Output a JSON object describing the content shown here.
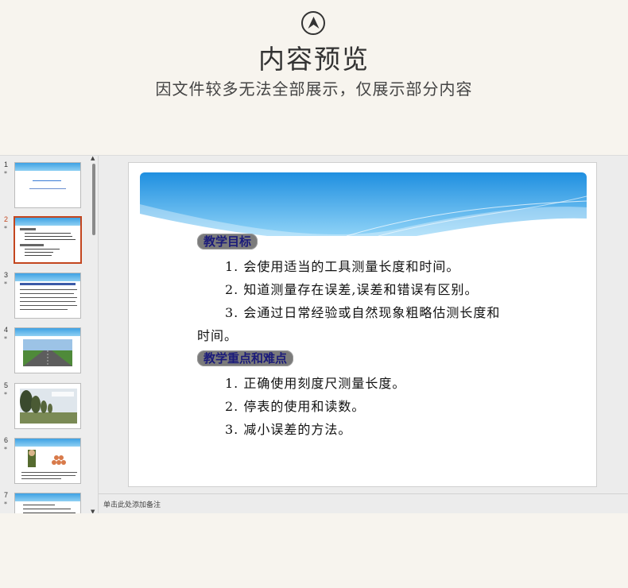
{
  "header": {
    "title": "内容预览",
    "subtitle": "因文件较多无法全部展示，仅展示部分内容",
    "icon": "upload-arrow-icon"
  },
  "thumbnails": [
    {
      "num": "1",
      "star": "*",
      "kind": "title"
    },
    {
      "num": "2",
      "star": "*",
      "kind": "text",
      "active": true
    },
    {
      "num": "3",
      "star": "*",
      "kind": "text"
    },
    {
      "num": "4",
      "star": "*",
      "kind": "road-photo"
    },
    {
      "num": "5",
      "star": "*",
      "kind": "trees-photo"
    },
    {
      "num": "6",
      "star": "*",
      "kind": "figure"
    },
    {
      "num": "7",
      "star": "*",
      "kind": "text"
    }
  ],
  "slide": {
    "heading1": "教学目标",
    "line1": "1. 会使用适当的工具测量长度和时间。",
    "line2": "2. 知道测量存在误差,误差和错误有区别。",
    "line3": "3. 会通过日常经验或自然现象粗略估测长度和",
    "line3b": "时间。",
    "heading2": "教学重点和难点",
    "line4": "1. 正确使用刻度尺测量长度。",
    "line5": "2. 停表的使用和读数。",
    "line6": "3. 减小误差的方法。"
  },
  "notes": {
    "placeholder": "单击此处添加备注"
  },
  "colors": {
    "accent": "#c3461f",
    "banner_blue": "#3ea1e3",
    "heading_bg": "#7b7b7b",
    "heading_text": "#1b1b7a"
  }
}
